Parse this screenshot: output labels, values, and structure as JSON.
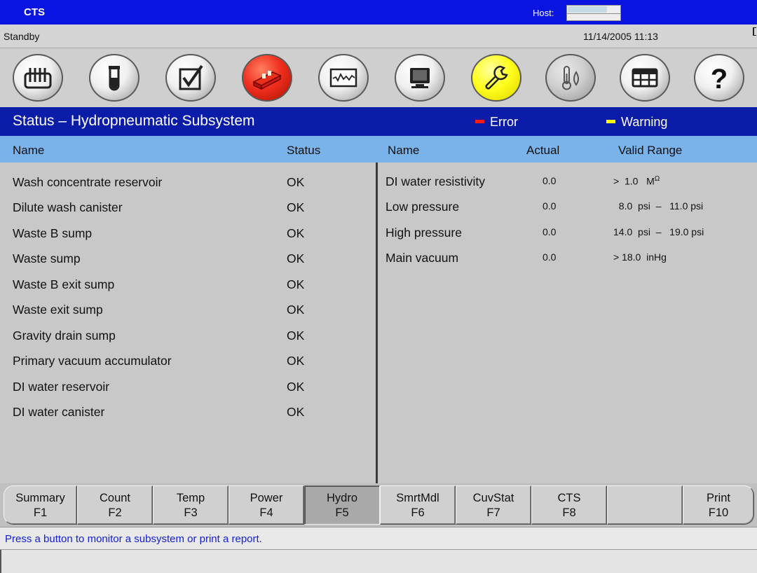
{
  "window": {
    "app_name": "CTS",
    "host_label": "Host:"
  },
  "status_line": {
    "mode": "Standby",
    "datetime": "11/14/2005 11:13"
  },
  "toolbar": {
    "icons": [
      "rack-icon",
      "test-tube-icon",
      "checklist-icon",
      "reagent-icon",
      "chart-icon",
      "monitor-icon",
      "wrench-icon",
      "temperature-icon",
      "printer-tray-icon",
      "help-icon"
    ],
    "colors": {
      "active": "#f03020",
      "selected": "#ffff20"
    }
  },
  "header": {
    "title": "Status – Hydropneumatic Subsystem",
    "legend": [
      {
        "label": "Error",
        "color": "#ff1a1a"
      },
      {
        "label": "Warning",
        "color": "#ffff00"
      }
    ]
  },
  "columns": {
    "left": {
      "name": "Name",
      "status": "Status"
    },
    "right": {
      "name": "Name",
      "actual": "Actual",
      "range": "Valid Range"
    }
  },
  "components": [
    {
      "name": "Wash concentrate reservoir",
      "status": "OK"
    },
    {
      "name": "Dilute wash canister",
      "status": "OK"
    },
    {
      "name": "Waste B sump",
      "status": "OK"
    },
    {
      "name": "Waste sump",
      "status": "OK"
    },
    {
      "name": "Waste B exit sump",
      "status": "OK"
    },
    {
      "name": "Waste exit sump",
      "status": "OK"
    },
    {
      "name": "Gravity drain sump",
      "status": "OK"
    },
    {
      "name": "Primary vacuum accumulator",
      "status": "OK"
    },
    {
      "name": "DI water reservoir",
      "status": "OK"
    },
    {
      "name": "DI water canister",
      "status": "OK"
    }
  ],
  "measurements": [
    {
      "name": "DI water resistivity",
      "actual": "0.0",
      "range": ">  1.0   M",
      "unit_symbol": "Ω"
    },
    {
      "name": "Low pressure",
      "actual": "0.0",
      "range": "  8.0  psi  –   11.0 psi"
    },
    {
      "name": "High pressure",
      "actual": "0.0",
      "range": "14.0  psi  –   19.0 psi"
    },
    {
      "name": "Main vacuum",
      "actual": "0.0",
      "range": "> 18.0  inHg"
    }
  ],
  "function_keys": [
    {
      "label": "Summary",
      "key": "F1"
    },
    {
      "label": "Count",
      "key": "F2"
    },
    {
      "label": "Temp",
      "key": "F3"
    },
    {
      "label": "Power",
      "key": "F4"
    },
    {
      "label": "Hydro",
      "key": "F5",
      "active": true
    },
    {
      "label": "SmrtMdl",
      "key": "F6"
    },
    {
      "label": "CuvStat",
      "key": "F7"
    },
    {
      "label": "CTS",
      "key": "F8"
    },
    {
      "label": "",
      "key": ""
    },
    {
      "label": "Print",
      "key": "F10"
    }
  ],
  "hint": "Press a button to monitor a subsystem or print a report."
}
